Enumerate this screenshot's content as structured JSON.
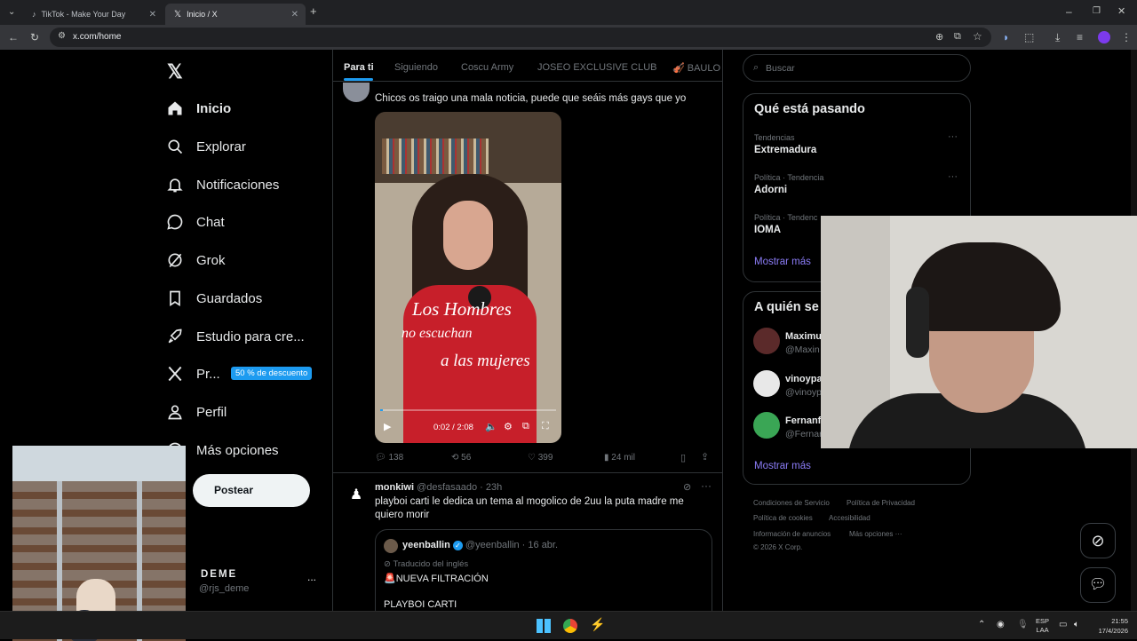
{
  "browser": {
    "tabs": [
      {
        "title": "TikTok - Make Your Day"
      },
      {
        "title": "Inicio / X"
      }
    ],
    "url": "x.com/home"
  },
  "nav": {
    "items": [
      {
        "label": "Inicio",
        "icon": "home-icon"
      },
      {
        "label": "Explorar",
        "icon": "search-icon"
      },
      {
        "label": "Notificaciones",
        "icon": "bell-icon"
      },
      {
        "label": "Chat",
        "icon": "chat-icon"
      },
      {
        "label": "Grok",
        "icon": "grok-icon"
      },
      {
        "label": "Guardados",
        "icon": "bookmark-icon"
      },
      {
        "label": "Estudio para cre...",
        "icon": "rocket-icon"
      },
      {
        "label": "Pr...",
        "icon": "x-logo-icon"
      },
      {
        "label": "Perfil",
        "icon": "person-icon"
      },
      {
        "label": "Más opciones",
        "icon": "more-circle-icon"
      }
    ],
    "premium_badge": "50 % de descuento",
    "post_button": "Postear",
    "account": {
      "name": "DEME",
      "handle": "@rjs_deme",
      "more": "..."
    }
  },
  "feed": {
    "tabs": [
      "Para ti",
      "Siguiendo",
      "Coscu Army",
      "JOSEO EXCLUSIVE CLUB",
      "🎻 BAULO C"
    ],
    "tweet1": {
      "text": "Chicos os traigo una mala noticia, puede que seáis más gays que yo",
      "video": {
        "time": "0:02 / 2:08",
        "caption_line1": "Los Hombres",
        "caption_line2": "no escuchan",
        "caption_line3": "a las mujeres",
        "progress": 0.016
      },
      "replies": "138",
      "reposts": "56",
      "likes": "399",
      "views": "24 mil"
    },
    "tweet2": {
      "name": "monkiwi",
      "handle_time": "@desfasaado · 23h",
      "text": "playboi carti le dedica un tema al mogolico de 2uu la puta madre me quiero morir",
      "quoted": {
        "name": "yeenballin",
        "handle_time": "@yeenballin · 16 abr.",
        "translated": "Traducido del inglés",
        "line1": "🚨NUEVA FILTRACIÓN",
        "line2": "PLAYBOI CARTI"
      }
    }
  },
  "right": {
    "search_placeholder": "Buscar",
    "trends_title": "Qué está pasando",
    "trends": [
      {
        "category": "Tendencias",
        "name": "Extremadura"
      },
      {
        "category": "Política · Tendencia",
        "name": "Adorni"
      },
      {
        "category": "Política · Tendenc",
        "name": "IOMA"
      }
    ],
    "show_more": "Mostrar más",
    "follow_title": "A quién se",
    "follow": [
      {
        "name": "Maximu",
        "handle": "@Maxin"
      },
      {
        "name": "vinoypa",
        "handle": "@vinoyp"
      },
      {
        "name": "Fernanf",
        "handle": "@Fernar"
      }
    ],
    "footer": {
      "terms": "Condiciones de Servicio",
      "privacy": "Política de Privacidad",
      "cookies": "Política de cookies",
      "access": "Accesibilidad",
      "ads": "Información de anuncios",
      "more": "Más opciones ···",
      "copyright": "© 2026 X Corp."
    }
  },
  "taskbar": {
    "lang_line1": "ESP",
    "lang_line2": "LAA",
    "time": "21:55",
    "date": "17/4/2026"
  },
  "colors": {
    "accent": "#1d9bf0",
    "badge": "#1d9bf0",
    "link_purple": "#8b7cf6"
  }
}
